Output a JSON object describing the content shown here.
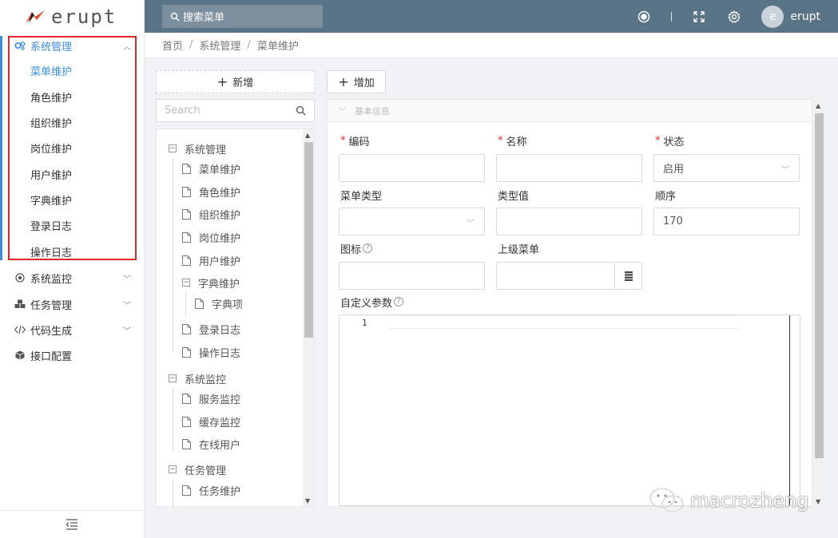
{
  "header": {
    "logo_text": "erupt",
    "search_placeholder": "搜索菜单",
    "username": "erupt",
    "avatar_letter": "e"
  },
  "sidebar": {
    "groups": [
      {
        "label": "系统管理",
        "open": true
      },
      {
        "label": "系统监控"
      },
      {
        "label": "任务管理"
      },
      {
        "label": "代码生成"
      },
      {
        "label": "接口配置"
      }
    ],
    "sub_items": [
      "菜单维护",
      "角色维护",
      "组织维护",
      "岗位维护",
      "用户维护",
      "字典维护",
      "登录日志",
      "操作日志"
    ],
    "active_sub": "菜单维护"
  },
  "breadcrumb": [
    "首页",
    "系统管理",
    "菜单维护"
  ],
  "tree": {
    "add_label": "新增",
    "search_placeholder": "Search",
    "nodes": [
      {
        "label": "系统管理"
      },
      {
        "label": "菜单维护"
      },
      {
        "label": "角色维护"
      },
      {
        "label": "组织维护"
      },
      {
        "label": "岗位维护"
      },
      {
        "label": "用户维护"
      },
      {
        "label": "字典维护"
      },
      {
        "label": "字典项"
      },
      {
        "label": "登录日志"
      },
      {
        "label": "操作日志"
      },
      {
        "label": "系统监控"
      },
      {
        "label": "服务监控"
      },
      {
        "label": "缓存监控"
      },
      {
        "label": "在线用户"
      },
      {
        "label": "任务管理"
      },
      {
        "label": "任务维护"
      }
    ]
  },
  "form": {
    "add_button": "增加",
    "section_title": "基本信息",
    "fields": {
      "code": {
        "label": "编码",
        "value": ""
      },
      "name": {
        "label": "名称",
        "value": ""
      },
      "status": {
        "label": "状态",
        "value": "启用"
      },
      "menu_type": {
        "label": "菜单类型",
        "value": ""
      },
      "type_value": {
        "label": "类型值",
        "value": ""
      },
      "order": {
        "label": "顺序",
        "value": "170"
      },
      "icon": {
        "label": "图标",
        "value": ""
      },
      "parent_menu": {
        "label": "上级菜单",
        "value": ""
      },
      "custom_params": {
        "label": "自定义参数",
        "line_number": "1"
      }
    }
  },
  "watermark": "macrozheng",
  "colors": {
    "header_bg": "#5a7487",
    "accent": "#3a8ee6",
    "highlight_border": "#e0262d",
    "required": "#f5222d"
  }
}
